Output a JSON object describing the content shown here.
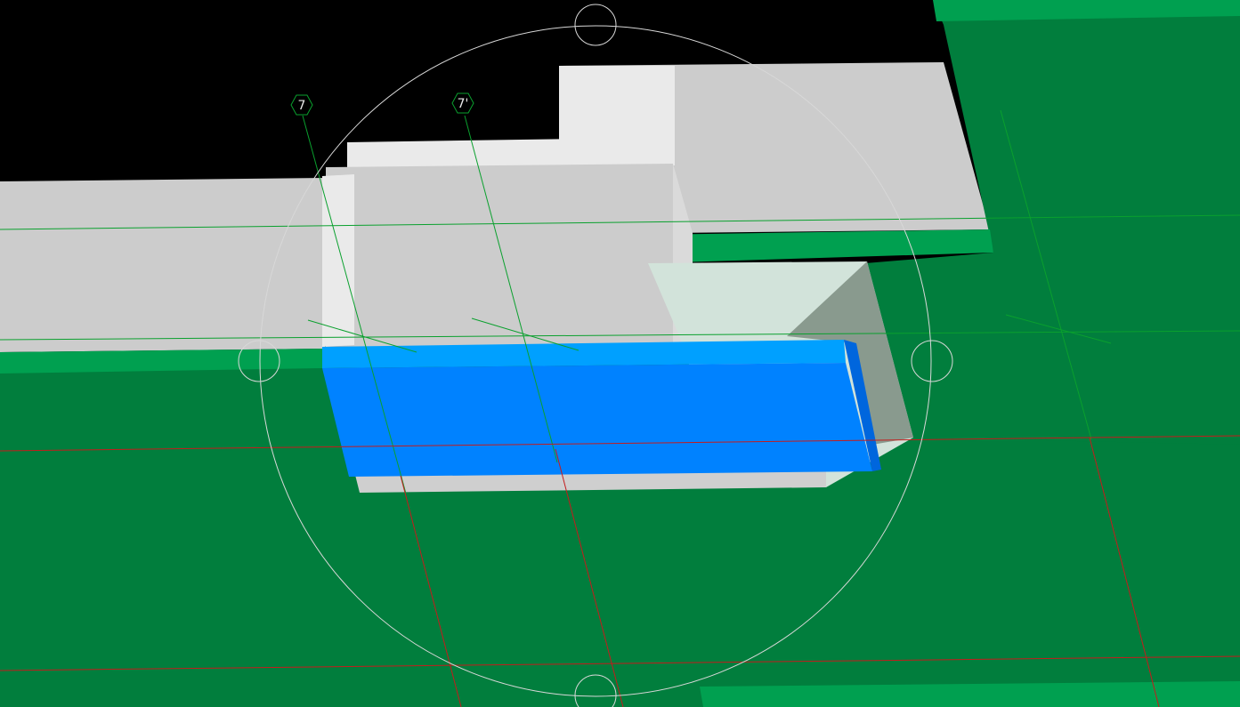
{
  "viewport": {
    "label": "3d-model-viewport",
    "background_color": "#000000",
    "colors": {
      "ground": "#017E3D",
      "ground_edge_light": "#00A050",
      "wall_face": "#CCCCCC",
      "wall_face_light": "#EAEAEA",
      "wall_shadow_face": "#899A8E",
      "transparent_face": "#D2E3DA",
      "selected_object_top": "#00A0FF",
      "selected_object_front": "#0082FF",
      "selected_object_side": "#0066DD",
      "grid_line_green": "#0AA02E",
      "grid_line_red": "#C41C1C",
      "orbit_circle": "#D8D8D8"
    }
  },
  "grid_markers": [
    {
      "label": "7",
      "icon": "grid-axis-marker-icon"
    },
    {
      "label": "7'",
      "icon": "grid-axis-marker-icon"
    }
  ],
  "orbit_tool": {
    "icon": "orbit-navigation-circle-icon",
    "handles": [
      "top",
      "right",
      "bottom",
      "left"
    ]
  },
  "selected_object": {
    "name": "selected-beam",
    "highlight_color": "#0082FF"
  }
}
